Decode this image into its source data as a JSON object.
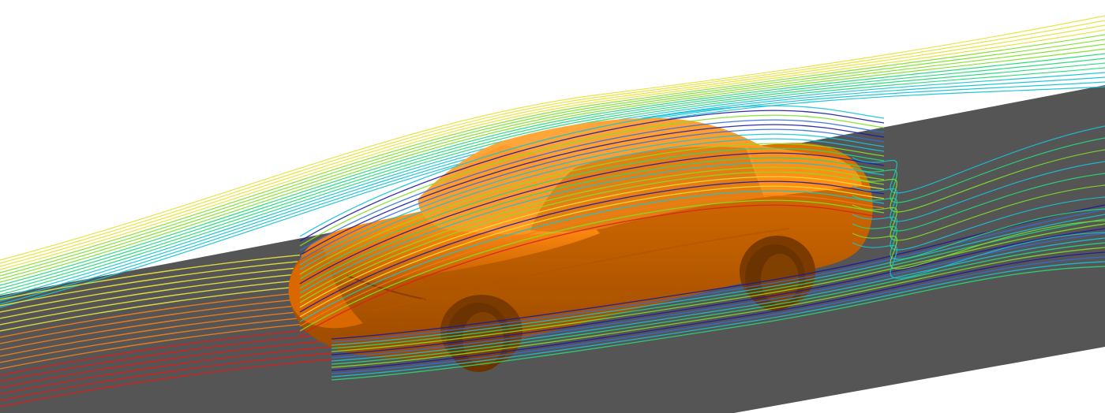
{
  "scene": {
    "subject": "car",
    "colors": {
      "background": "#ffffff",
      "ground": "#555555",
      "car_body": "#ff8300",
      "car_shadow": "#a34e00",
      "tire": "#6b3300"
    },
    "streamline_palette": [
      "#1a1aa6",
      "#2f6fe0",
      "#17c3d6",
      "#25d97a",
      "#7fe02a",
      "#e8e23a",
      "#f07c1a",
      "#d92020"
    ]
  }
}
